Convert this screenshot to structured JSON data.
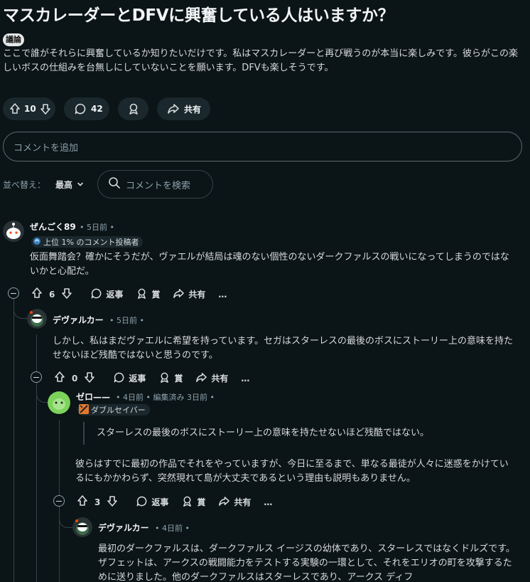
{
  "post": {
    "title": "マスカレーダーとDFVに興奮している人はいますか？",
    "flair": "議論",
    "body": "ここで誰がそれらに興奮しているか知りたいだけです。私はマスカレーダーと再び戦うのが本当に楽しみです。彼らがこの楽しいボスの仕組みを台無しにしていないことを願います。DFVも楽しそうです。",
    "votes": "10",
    "comments": "42",
    "share_label": "共有"
  },
  "comment_input": {
    "placeholder": "コメントを追加"
  },
  "sort": {
    "label": "並べ替え：",
    "value": "最高"
  },
  "search": {
    "placeholder": "コメントを検索"
  },
  "comments": [
    {
      "author": "ぜんごく89",
      "time": "• 5日前 •",
      "badge": "上位 1% のコメント投稿者",
      "text": "仮面舞踏会？確かにそうだが、ヴァエルが結局は魂のない個性のないダークファルスの戦いになってしまうのではないかと心配だ。",
      "votes": "6",
      "reply": "返事",
      "award": "賞",
      "share": "共有",
      "more": "…"
    },
    {
      "author": "デヴァルカー",
      "time": "• 5日前 •",
      "text": "しかし、私はまだヴァエルに希望を持っています。セガはスターレスの最後のボスにストーリー上の意味を持たせないほど残酷ではないと思うのです。",
      "votes": "0",
      "reply": "返事",
      "award": "賞",
      "share": "共有",
      "more": "…"
    },
    {
      "author": "ゼロ——",
      "time": "• 4日前 • 編集済み 3日前 •",
      "badge": "ダブルセイバー",
      "quote": "スターレスの最後のボスにストーリー上の意味を持たせないほど残酷ではない。",
      "text": "彼らはすでに最初の作品でそれをやっていますが、今日に至るまで、単なる最徒が人々に迷惑をかけているにもかかわらず、突然現れて島が大丈夫であるという理由も説明もありません。",
      "votes": "3",
      "reply": "返事",
      "award": "賞",
      "share": "共有",
      "more": "…"
    },
    {
      "author": "デヴァルカー",
      "time": "• 4日前 •",
      "text": "最初のダークファルスは、ダークファルス イージスの幼体であり、スターレスではなくドルズです。ザフェットは、アークスの戦闘能力をテストする実験の一環として、それをエリオの町を攻撃するために送りました。他のダークファルスはスターレスであり、アークス ディフ"
    }
  ],
  "colors": {
    "background": "#0b1416",
    "text": "#d7dadc",
    "meta": "#8ba2ad",
    "pill": "#1a282d",
    "link_accent": "#648efc"
  }
}
